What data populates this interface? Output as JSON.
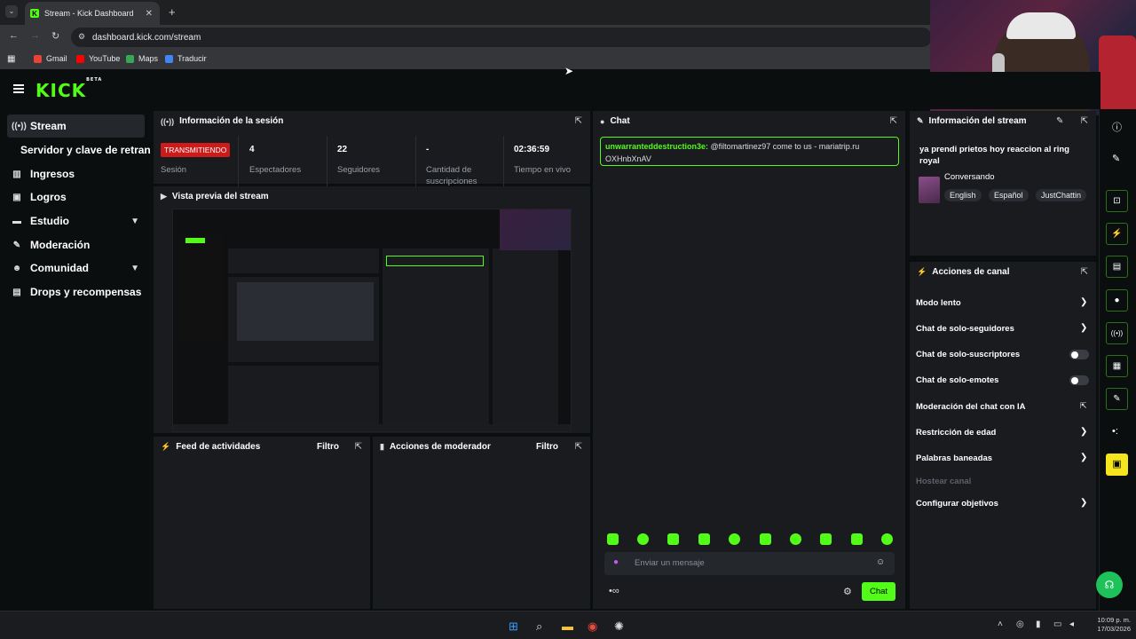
{
  "browser": {
    "tab_title": "Stream - Kick Dashboard",
    "url": "dashboard.kick.com/stream",
    "bookmarks": [
      "Gmail",
      "YouTube",
      "Maps",
      "Traducir"
    ]
  },
  "brand": {
    "logo": "KICK",
    "badge": "BETA",
    "accent": "#53fc18"
  },
  "sidebar": {
    "items": [
      {
        "label": "Stream",
        "icon": "broadcast-icon",
        "active": true
      },
      {
        "label": "Servidor y clave de retransm",
        "icon": ""
      },
      {
        "label": "Ingresos",
        "icon": "chart-icon"
      },
      {
        "label": "Logros",
        "icon": "trophy-icon"
      },
      {
        "label": "Estudio",
        "icon": "studio-icon",
        "expandable": true
      },
      {
        "label": "Moderación",
        "icon": "wrench-icon"
      },
      {
        "label": "Comunidad",
        "icon": "users-icon",
        "expandable": true
      },
      {
        "label": "Drops y recompensas",
        "icon": "gift-icon"
      }
    ]
  },
  "session": {
    "title": "Información de la sesión",
    "status_badge": "TRANSMITIENDO",
    "status_label": "Sesión",
    "viewers_value": "4",
    "viewers_label": "Espectadores",
    "followers_value": "22",
    "followers_label": "Seguidores",
    "subs_value": "-",
    "subs_label": "Cantidad de suscripciones",
    "live_value": "02:36:59",
    "live_label": "Tiempo en vivo"
  },
  "preview": {
    "title": "Vista previa del stream"
  },
  "feed": {
    "title": "Feed de actividades",
    "filter": "Filtro"
  },
  "modactions": {
    "title": "Acciones de moderador",
    "filter": "Filtro"
  },
  "chat": {
    "title": "Chat",
    "message_user": "unwarranteddestruction3e:",
    "message_text": "@filtomartinez97 come to us - mariatrip.ru OXHnbXnAV",
    "input_placeholder": "Enviar un mensaje",
    "send_button": "Chat"
  },
  "stream_info": {
    "title": "Información del stream",
    "stream_title": "ya prendi prietos hoy reaccion al ring royal",
    "category": "Conversando",
    "tags": [
      "English",
      "Español",
      "JustChattin"
    ]
  },
  "channel_actions": {
    "title": "Acciones de canal",
    "items": [
      {
        "label": "Modo lento",
        "control": "chevron"
      },
      {
        "label": "Chat de solo-seguidores",
        "control": "chevron"
      },
      {
        "label": "Chat de solo-suscriptores",
        "control": "toggle"
      },
      {
        "label": "Chat de solo-emotes",
        "control": "toggle"
      },
      {
        "label": "Moderación del chat con IA",
        "control": "external"
      },
      {
        "label": "Restricción de edad",
        "control": "chevron"
      },
      {
        "label": "Palabras baneadas",
        "control": "chevron"
      },
      {
        "label": "Hostear canal",
        "control": "disabled"
      },
      {
        "label": "Configurar objetivos",
        "control": "chevron"
      }
    ]
  },
  "taskbar": {
    "time": "10:09 p. m.",
    "date": "17/03/2026"
  }
}
